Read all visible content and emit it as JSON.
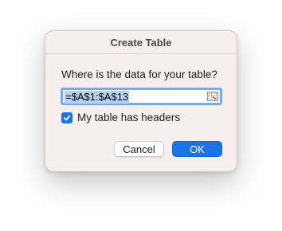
{
  "dialog": {
    "title": "Create Table",
    "prompt": "Where is the data for your table?",
    "range": {
      "value": "=$A$1:$A$13",
      "selected": true
    },
    "collapse_icon": "range-collapse-icon",
    "headers_checkbox": {
      "label": "My table has headers",
      "checked": true
    },
    "buttons": {
      "cancel_label": "Cancel",
      "ok_label": "OK"
    }
  },
  "colors": {
    "accent": "#1a74e8",
    "dialog_background": "#f6efee",
    "selection_highlight": "#b3d2f7",
    "focus_ring": "#7aa9f0"
  }
}
